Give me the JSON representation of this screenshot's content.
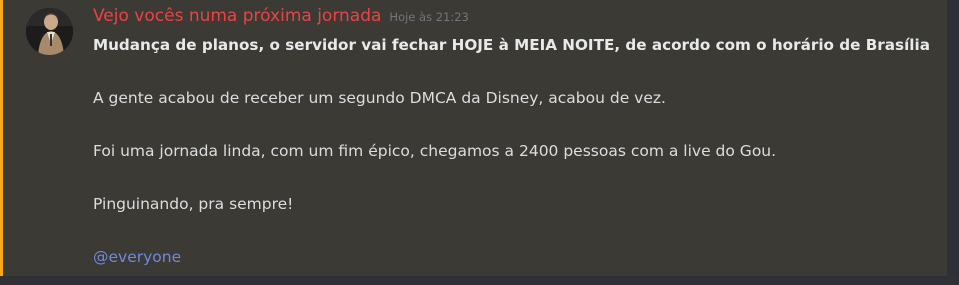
{
  "message": {
    "author": "Vejo vocês numa próxima jornada",
    "timestamp": "Hoje às 21:23",
    "lines": [
      "Mudança de planos, o servidor vai fechar HOJE à MEIA NOITE, de acordo com o horário de Brasília",
      "A gente acabou de receber um segundo DMCA da Disney, acabou de vez.",
      "Foi uma jornada linda, com um fim épico, chegamos a 2400 pessoas com a live do Gou.",
      "Pinguinando, pra sempre!"
    ],
    "mention": "@everyone"
  },
  "colors": {
    "highlight_border": "#faa81a",
    "username": "#ed4245",
    "mention": "#7289da"
  }
}
